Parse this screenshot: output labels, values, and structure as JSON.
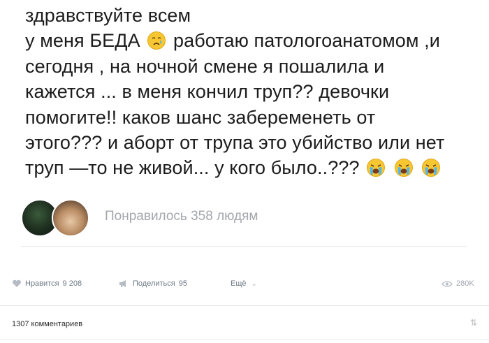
{
  "post": {
    "lines": [
      {
        "text": "здравствуйте всем"
      },
      {
        "before": "у меня БЕДА",
        "after": "работаю патологоанатомом ,и"
      },
      {
        "text": "сегодня , на ночной смене я пошалила и"
      },
      {
        "text": "кажется ... в меня кончил труп?? девочки"
      },
      {
        "text": "помогите!! каков шанс забеременеть от"
      },
      {
        "text": "этого??? и аборт от трупа это убийство или нет"
      },
      {
        "before": "труп —то не живой...  у кого было..???"
      }
    ],
    "emoji": {
      "line2": "crying-face",
      "line7": [
        "loudly-crying-face",
        "loudly-crying-face",
        "loudly-crying-face"
      ]
    }
  },
  "likers": {
    "text": "Понравилось 358 людям"
  },
  "actions": {
    "like_label": "Нравится",
    "like_count": "9 208",
    "share_label": "Поделиться",
    "share_count": "95",
    "more_label": "Ещё",
    "views": "280K"
  },
  "comments": {
    "count_text": "1307 комментариев"
  },
  "colors": {
    "text": "#1c1c1c",
    "muted": "#a3a7ad",
    "action": "#6d7885",
    "divider": "#e5e6e8"
  }
}
